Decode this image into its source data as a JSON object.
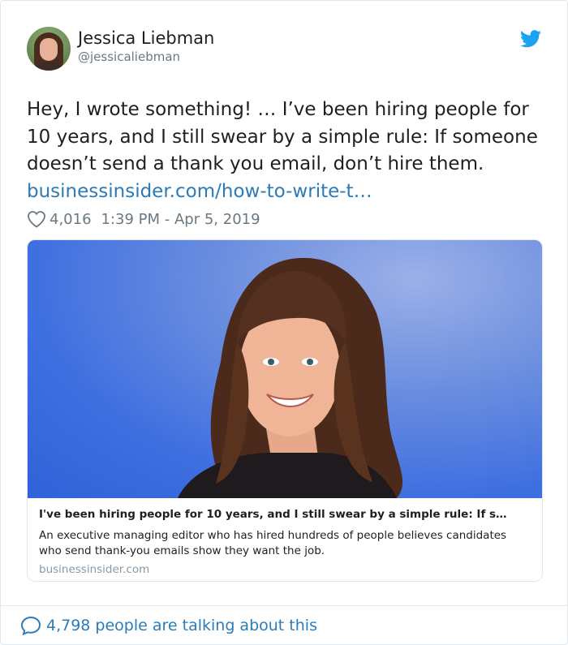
{
  "author": {
    "name": "Jessica Liebman",
    "handle": "@jessicaliebman",
    "avatar_icon": "user-avatar",
    "platform_icon": "twitter-bird-icon",
    "platform_color": "#1da1f2"
  },
  "tweet": {
    "text": "Hey, I wrote something! … I’ve been hiring people for 10 years, and I still swear by a simple rule: If someone doesn’t send a thank you email, don’t hire them.",
    "link_text": "businessinsider.com/how-to-write-t…",
    "link_color": "#2b7bb9"
  },
  "meta": {
    "like_icon": "heart-icon",
    "likes": "4,016",
    "timestamp": "1:39 PM - Apr 5, 2019"
  },
  "card": {
    "title": "I've been hiring people for 10 years, and I still swear by a simple rule: If s…",
    "description": "An executive managing editor who has hired hundreds of people believes candidates who send thank-you emails show they want the job.",
    "domain": "businessinsider.com"
  },
  "footer": {
    "icon": "speech-bubble-icon",
    "label": "4,798 people are talking about this"
  }
}
